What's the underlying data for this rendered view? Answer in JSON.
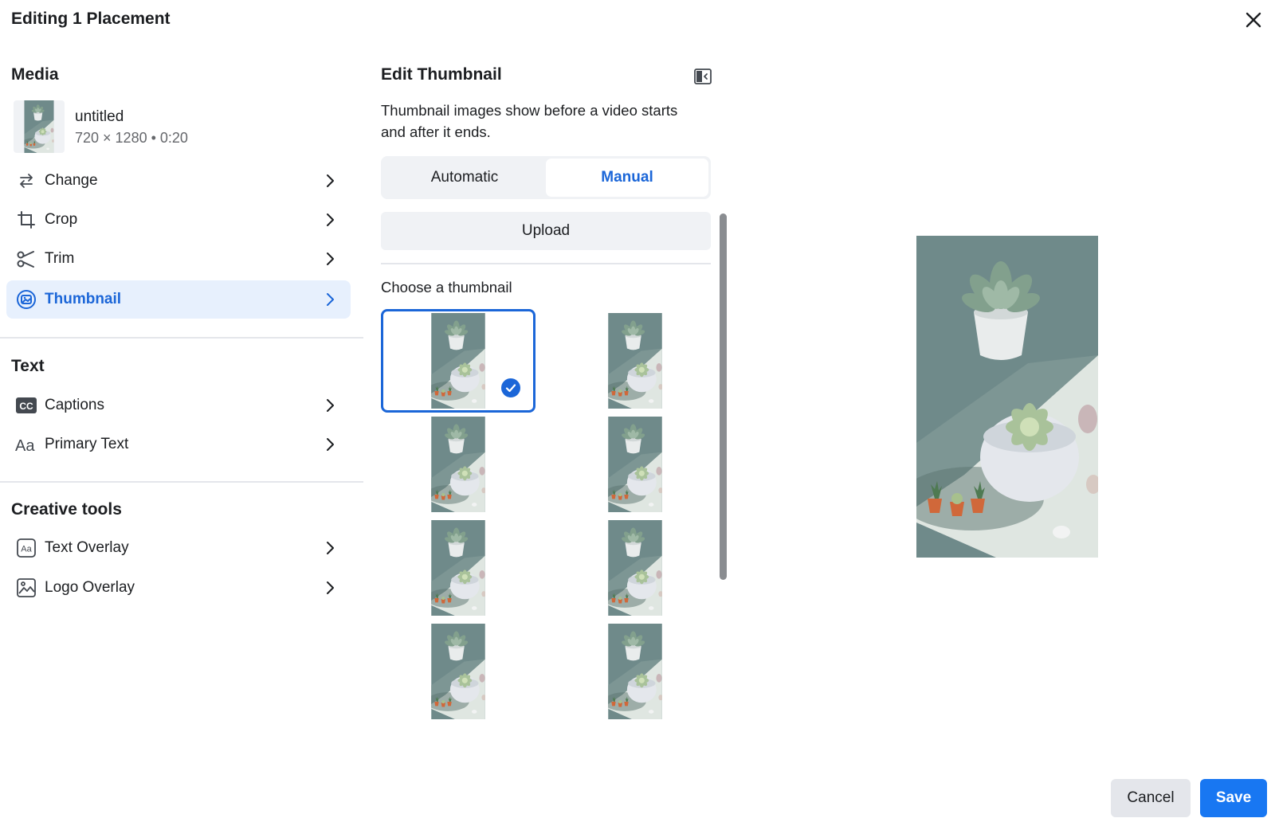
{
  "dialog": {
    "title": "Editing 1 Placement"
  },
  "media": {
    "heading": "Media",
    "file_name": "untitled",
    "file_meta": "720 × 1280 • 0:20",
    "items": [
      {
        "label": "Change",
        "icon": "swap-arrows-icon"
      },
      {
        "label": "Crop",
        "icon": "crop-icon"
      },
      {
        "label": "Trim",
        "icon": "scissors-icon"
      },
      {
        "label": "Thumbnail",
        "icon": "thumbnail-icon",
        "active": true
      }
    ]
  },
  "text_section": {
    "heading": "Text",
    "items": [
      {
        "label": "Captions",
        "icon": "cc-icon"
      },
      {
        "label": "Primary Text",
        "icon": "font-aa-icon"
      }
    ]
  },
  "creative_tools": {
    "heading": "Creative tools",
    "items": [
      {
        "label": "Text Overlay",
        "icon": "text-overlay-icon"
      },
      {
        "label": "Logo Overlay",
        "icon": "image-icon"
      }
    ]
  },
  "edit_thumbnail": {
    "heading": "Edit Thumbnail",
    "description": "Thumbnail images show before a video starts and after it ends.",
    "modes": [
      "Automatic",
      "Manual"
    ],
    "selected_mode": "Manual",
    "upload_label": "Upload",
    "choose_label": "Choose a thumbnail",
    "thumbnail_count": 8,
    "selected_thumbnail_index": 0
  },
  "footer": {
    "cancel_label": "Cancel",
    "save_label": "Save"
  },
  "colors": {
    "accent": "#1877f2",
    "active_text": "#1b66d8",
    "active_bg": "#e7f0fd",
    "photo_bg": "#6f8a8a"
  }
}
